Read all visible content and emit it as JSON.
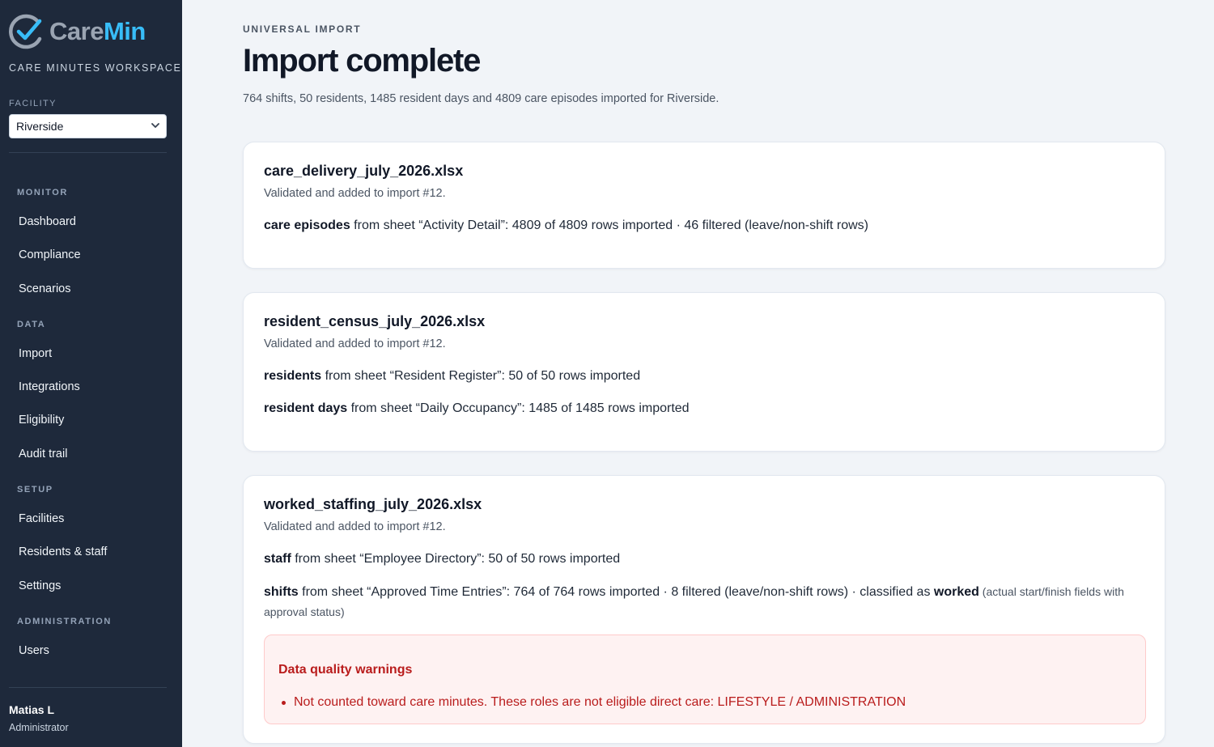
{
  "sidebar": {
    "brand": {
      "care": "Care",
      "min": "Min"
    },
    "workspace": "CARE MINUTES WORKSPACE",
    "facility_label": "FACILITY",
    "facility_value": "Riverside",
    "sections": [
      {
        "title": "MONITOR",
        "items": [
          "Dashboard",
          "Compliance",
          "Scenarios"
        ]
      },
      {
        "title": "DATA",
        "items": [
          "Import",
          "Integrations",
          "Eligibility",
          "Audit trail"
        ]
      },
      {
        "title": "SETUP",
        "items": [
          "Facilities",
          "Residents & staff",
          "Settings"
        ]
      },
      {
        "title": "ADMINISTRATION",
        "items": [
          "Users"
        ]
      }
    ],
    "user": {
      "name": "Matias L",
      "role": "Administrator"
    }
  },
  "main": {
    "eyebrow": "UNIVERSAL IMPORT",
    "title": "Import complete",
    "summary": "764 shifts, 50 residents, 1485 resident days and 4809 care episodes imported for Riverside.",
    "cards": [
      {
        "file": "care_delivery_july_2026.xlsx",
        "status": "Validated and added to import #12.",
        "lines": [
          {
            "label": "care episodes",
            "text": " from sheet “Activity Detail”: 4809 of 4809 rows imported · 46 filtered (leave/non-shift rows)"
          }
        ]
      },
      {
        "file": "resident_census_july_2026.xlsx",
        "status": "Validated and added to import #12.",
        "lines": [
          {
            "label": "residents",
            "text": " from sheet “Resident Register”: 50 of 50 rows imported"
          },
          {
            "label": "resident days",
            "text": " from sheet “Daily Occupancy”: 1485 of 1485 rows imported"
          }
        ]
      },
      {
        "file": "worked_staffing_july_2026.xlsx",
        "status": "Validated and added to import #12.",
        "lines": [
          {
            "label": "staff",
            "text": " from sheet “Employee Directory”: 50 of 50 rows imported"
          },
          {
            "label": "shifts",
            "text": " from sheet “Approved Time Entries”: 764 of 764 rows imported · 8 filtered (leave/non-shift rows) · classified as ",
            "emph": "worked",
            "note": " (actual start/finish fields with approval status)"
          }
        ],
        "warnings": {
          "title": "Data quality warnings",
          "items": [
            "Not counted toward care minutes. These roles are not eligible direct care: LIFESTYLE / ADMINISTRATION"
          ]
        }
      }
    ]
  },
  "colors": {
    "sidebar_bg": "#1e293b",
    "brand_accent": "#38bdf8",
    "warning": "#b91c1c",
    "warning_bg": "#fef2f2"
  }
}
